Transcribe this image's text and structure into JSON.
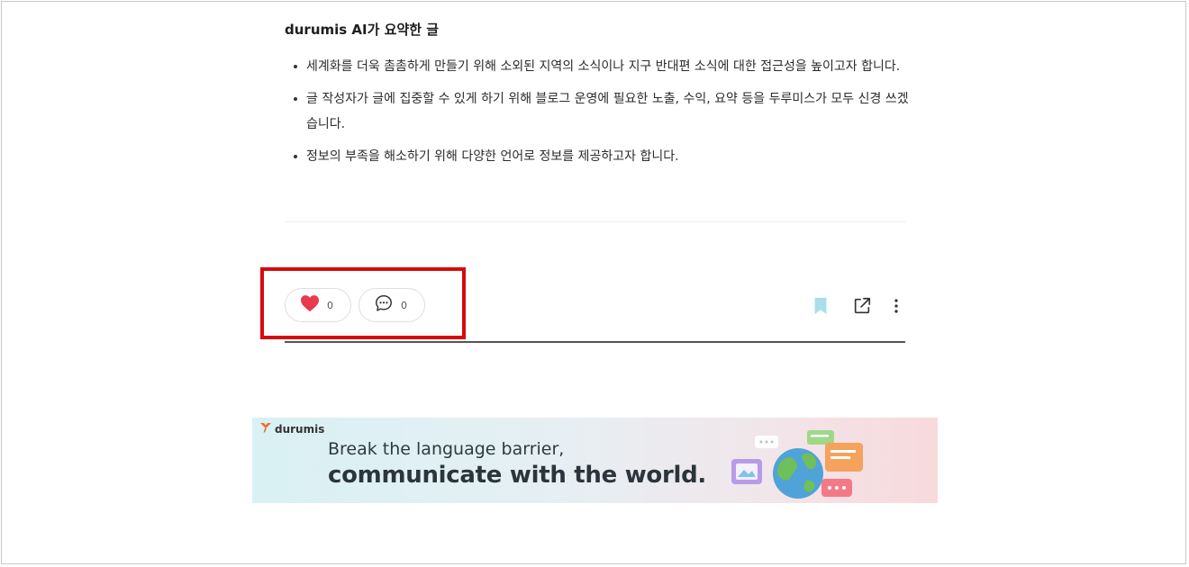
{
  "summary": {
    "title": "durumis AI가 요약한 글",
    "items": [
      "세계화를 더욱 촘촘하게 만들기 위해 소외된 지역의 소식이나 지구 반대편 소식에 대한 접근성을 높이고자 합니다.",
      "글 작성자가 글에 집중할 수 있게 하기 위해 블로그 운영에 필요한 노출, 수익, 요약 등을 두루미스가 모두 신경 쓰겠습니다.",
      "정보의 부족을 해소하기 위해 다양한 언어로 정보를 제공하고자 합니다."
    ]
  },
  "actions": {
    "like_count": "0",
    "comment_count": "0",
    "like_color": "#e8394f",
    "bookmark_color": "#a8dfe6",
    "highlight_color": "#d60b0b"
  },
  "icons": {
    "like": "heart-icon",
    "comment": "speech-bubble-icon",
    "bookmark": "bookmark-icon",
    "share": "external-link-icon",
    "more": "more-vertical-icon"
  },
  "banner": {
    "brand": "durumis",
    "line1": "Break the language barrier,",
    "line2": "communicate with the world."
  }
}
